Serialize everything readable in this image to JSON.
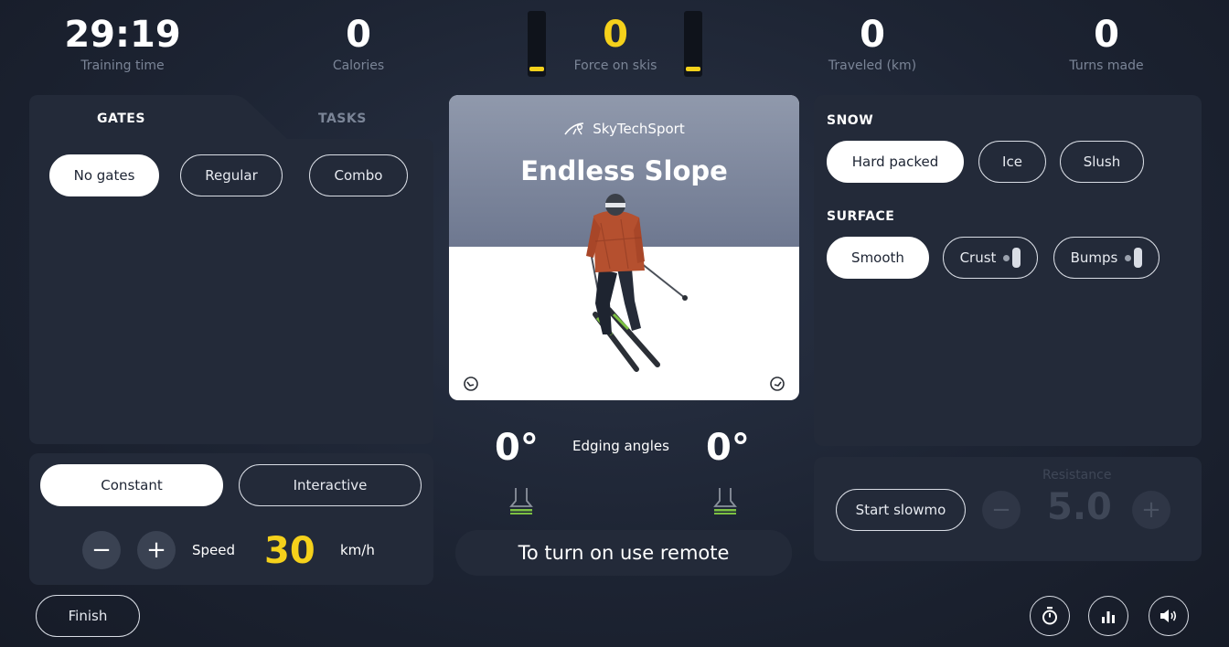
{
  "stats": {
    "training_time": {
      "value": "29:19",
      "label": "Training time"
    },
    "calories": {
      "value": "0",
      "label": "Calories"
    },
    "force": {
      "value": "0",
      "label": "Force on skis"
    },
    "traveled": {
      "value": "0",
      "label": "Traveled (km)"
    },
    "turns": {
      "value": "0",
      "label": "Turns made"
    }
  },
  "left_panel": {
    "tabs": [
      {
        "label": "GATES"
      },
      {
        "label": "TASKS"
      }
    ],
    "gate_options": [
      {
        "label": "No gates",
        "active": true
      },
      {
        "label": "Regular",
        "active": false
      },
      {
        "label": "Combo",
        "active": false
      }
    ]
  },
  "speed_panel": {
    "modes": [
      {
        "label": "Constant",
        "active": true
      },
      {
        "label": "Interactive",
        "active": false
      }
    ],
    "minus": "−",
    "plus": "+",
    "speed_label": "Speed",
    "speed_value": "30",
    "speed_unit": "km/h"
  },
  "preview": {
    "brand": "SkyTechSport",
    "title": "Endless Slope"
  },
  "edging": {
    "left_value": "0°",
    "right_value": "0°",
    "label": "Edging angles"
  },
  "remote_hint": "To turn on use remote",
  "right_panel": {
    "snow_title": "SNOW",
    "snow_options": [
      {
        "label": "Hard packed",
        "active": true
      },
      {
        "label": "Ice",
        "active": false
      },
      {
        "label": "Slush",
        "active": false
      }
    ],
    "surface_title": "SURFACE",
    "surface_options": [
      {
        "label": "Smooth",
        "active": true
      },
      {
        "label": "Crust",
        "active": false
      },
      {
        "label": "Bumps",
        "active": false
      }
    ]
  },
  "resistance_panel": {
    "slowmo_label": "Start slowmo",
    "resistance_label": "Resistance",
    "resistance_value": "5.0",
    "minus": "−",
    "plus": "+"
  },
  "footer": {
    "finish_label": "Finish",
    "icons": [
      "stopwatch-icon",
      "bar-chart-icon",
      "speaker-icon"
    ]
  },
  "colors": {
    "accent_yellow": "#f5d11b",
    "background": "#1d2433",
    "panel": "#232a39",
    "muted_text": "#7b8597"
  }
}
